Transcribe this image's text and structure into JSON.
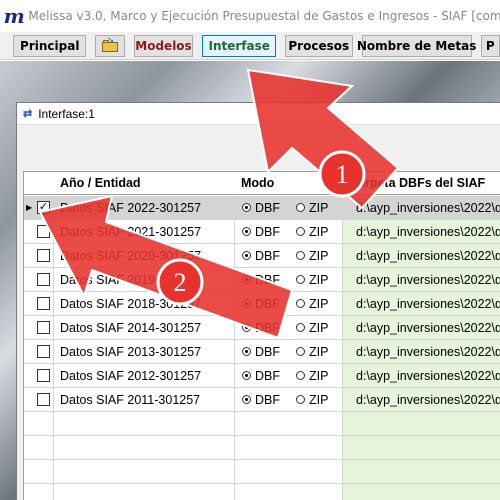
{
  "app": {
    "logo": "m",
    "title": "Melissa v3.0, Marco y Ejecución Presupuestal de Gastos e Ingresos - SIAF   [compilación 3"
  },
  "toolbar": {
    "principal": "Principal",
    "folder_icon": "folder-open-icon",
    "modelos": "Modelos",
    "interfase": "Interfase",
    "procesos": "Procesos",
    "nombre_metas": "Nombre de Metas",
    "extra": "P"
  },
  "window": {
    "icon": "window-arrows-icon",
    "title": "Interfase:1"
  },
  "grid": {
    "headers": {
      "anio": "Año / Entidad",
      "modo": "Modo",
      "carpeta": "Carpeta DBFs del SIAF"
    },
    "rows": [
      {
        "name": "Datos SIAF 2022-301257",
        "checked": true,
        "mode_dbf": "DBF",
        "mode_zip": "ZIP",
        "dbf_selected": true,
        "folder": "d:\\ayp_inversiones\\2022\\d",
        "selected": true
      },
      {
        "name": "Datos SIAF 2021-301257",
        "checked": false,
        "mode_dbf": "DBF",
        "mode_zip": "ZIP",
        "dbf_selected": true,
        "folder": "d:\\ayp_inversiones\\2022\\d",
        "selected": false
      },
      {
        "name": "Datos SIAF 2020-301257",
        "checked": false,
        "mode_dbf": "DBF",
        "mode_zip": "ZIP",
        "dbf_selected": true,
        "folder": "d:\\ayp_inversiones\\2022\\d",
        "selected": false
      },
      {
        "name": "Datos SIAF 2019-301257",
        "checked": false,
        "mode_dbf": "DBF",
        "mode_zip": "ZIP",
        "dbf_selected": true,
        "folder": "d:\\ayp_inversiones\\2022\\d",
        "selected": false
      },
      {
        "name": "Datos SIAF 2018-301257",
        "checked": false,
        "mode_dbf": "DBF",
        "mode_zip": "ZIP",
        "dbf_selected": true,
        "folder": "d:\\ayp_inversiones\\2022\\d",
        "selected": false
      },
      {
        "name": "Datos SIAF 2014-301257",
        "checked": false,
        "mode_dbf": "DBF",
        "mode_zip": "ZIP",
        "dbf_selected": true,
        "folder": "d:\\ayp_inversiones\\2022\\d",
        "selected": false
      },
      {
        "name": "Datos SIAF 2013-301257",
        "checked": false,
        "mode_dbf": "DBF",
        "mode_zip": "ZIP",
        "dbf_selected": true,
        "folder": "d:\\ayp_inversiones\\2022\\d",
        "selected": false
      },
      {
        "name": "Datos SIAF 2012-301257",
        "checked": false,
        "mode_dbf": "DBF",
        "mode_zip": "ZIP",
        "dbf_selected": true,
        "folder": "d:\\ayp_inversiones\\2022\\d",
        "selected": false
      },
      {
        "name": "Datos SIAF 2011-301257",
        "checked": false,
        "mode_dbf": "DBF",
        "mode_zip": "ZIP",
        "dbf_selected": true,
        "folder": "d:\\ayp_inversiones\\2022\\d",
        "selected": false
      }
    ]
  },
  "annotations": {
    "arrow1_label": "1",
    "arrow2_label": "2",
    "arrow_color": "#e8322e"
  }
}
